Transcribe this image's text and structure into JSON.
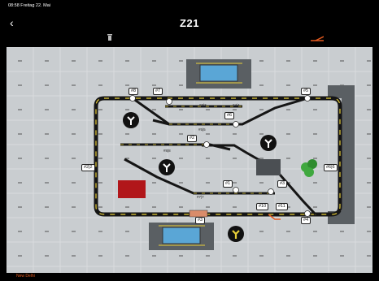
{
  "status_bar": {
    "time_date": "08:58  Freitag 22. Mai"
  },
  "header": {
    "title": "Z21"
  },
  "layout": {
    "labels": [
      {
        "id": "n8",
        "text": "#8"
      },
      {
        "id": "n7",
        "text": "#7"
      },
      {
        "id": "n3_3",
        "text": "#3|3"
      },
      {
        "id": "n4_4",
        "text": "#4|4"
      },
      {
        "id": "n5",
        "text": "#5"
      },
      {
        "id": "n6",
        "text": "#6"
      },
      {
        "id": "n5_5",
        "text": "#5|5"
      },
      {
        "id": "n2",
        "text": "#2"
      },
      {
        "id": "n8_8",
        "text": "#8|8"
      },
      {
        "id": "n2_2",
        "text": "#2|2"
      },
      {
        "id": "n6_6",
        "text": "#6|6"
      },
      {
        "id": "n1",
        "text": "#1"
      },
      {
        "id": "n3",
        "text": "#3"
      },
      {
        "id": "n7_7",
        "text": "#7|7"
      },
      {
        "id": "n10",
        "text": "#10"
      },
      {
        "id": "n11",
        "text": "#11"
      },
      {
        "id": "n4",
        "text": "#4"
      },
      {
        "id": "n3b",
        "text": "#3"
      }
    ]
  },
  "bottom_bar": {
    "text": "New Delhi"
  }
}
